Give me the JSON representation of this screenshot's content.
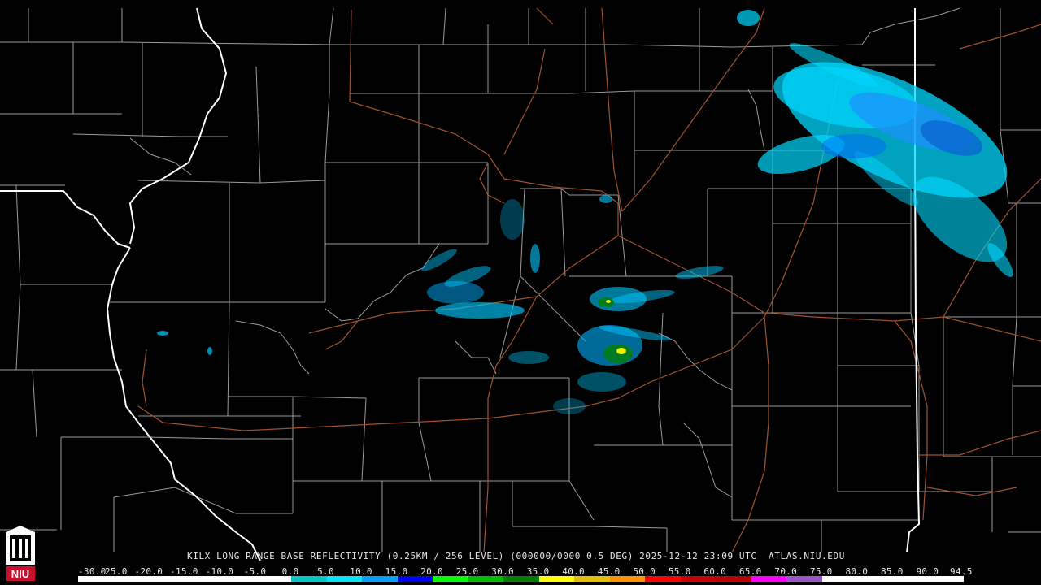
{
  "product": {
    "caption": "KILX LONG RANGE BASE REFLECTIVITY (0.25KM / 256 LEVEL) (000000/0000 0.5 DEG) 2025-12-12 23:09 UTC  ATLAS.NIU.EDU"
  },
  "logo": {
    "text": "NIU",
    "icon": "niu-seal-icon"
  },
  "colorbar": {
    "labels": [
      "-30.0",
      "-25.0",
      "-20.0",
      "-15.0",
      "-10.0",
      "-5.0",
      "0.0",
      "5.0",
      "10.0",
      "15.0",
      "20.0",
      "25.0",
      "30.0",
      "35.0",
      "40.0",
      "45.0",
      "50.0",
      "55.0",
      "60.0",
      "65.0",
      "70.0",
      "75.0",
      "80.0",
      "85.0",
      "90.0",
      "94.5"
    ],
    "colors": [
      "#ffffff",
      "#ffffff",
      "#ffffff",
      "#ffffff",
      "#ffffff",
      "#ffffff",
      "#00c8c8",
      "#00e6ff",
      "#00a0ff",
      "#0000ff",
      "#00ff00",
      "#00c000",
      "#008000",
      "#ffff00",
      "#e6c000",
      "#ff9000",
      "#ff0000",
      "#d00000",
      "#c00000",
      "#ff00ff",
      "#9955c9",
      "#ffffff",
      "#ffffff",
      "#ffffff",
      "#ffffff"
    ]
  },
  "colors": {
    "background": "#000000",
    "county_lines": "#a0a0a0",
    "state_lines": "#ffffff",
    "highways": "#a0522d",
    "echo_light": "#00d8ff",
    "echo_mid": "#0070ff",
    "echo_green": "#00c000",
    "echo_yellow": "#ffff00"
  }
}
